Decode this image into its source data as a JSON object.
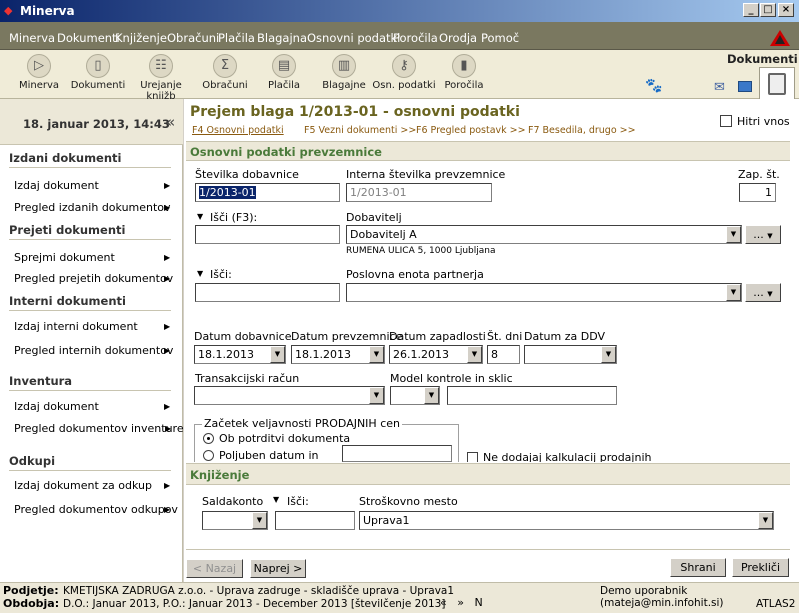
{
  "window": {
    "title": "Minerva"
  },
  "menu": [
    "Minerva",
    "Dokumenti",
    "Knjiženje",
    "Obračuni",
    "Plačila",
    "Blagajna",
    "Osnovni podatki",
    "Poročila",
    "Orodja",
    "Pomoč"
  ],
  "toolbar": {
    "buttons": [
      "Minerva",
      "Dokumenti",
      "Urejanje knjižb",
      "Obračuni",
      "Plačila",
      "Blagajne",
      "Osn. podatki",
      "Poročila"
    ],
    "tab_label": "Dokumenti"
  },
  "left": {
    "datetime": "18. januar 2013, 14:43",
    "collapse": "«",
    "sections": [
      {
        "title": "Izdani dokumenti",
        "items": [
          "Izdaj dokument",
          "Pregled izdanih dokumentov"
        ]
      },
      {
        "title": "Prejeti dokumenti",
        "items": [
          "Sprejmi dokument",
          "Pregled prejetih dokumentov"
        ]
      },
      {
        "title": "Interni dokumenti",
        "items": [
          "Izdaj interni dokument",
          "Pregled internih dokumentov"
        ]
      },
      {
        "title": "Inventura",
        "items": [
          "Izdaj dokument",
          "Pregled dokumentov inventure"
        ]
      },
      {
        "title": "Odkupi",
        "items": [
          "Izdaj dokument za odkup",
          "Pregled dokumentov odkupov"
        ]
      }
    ]
  },
  "main": {
    "title": "Prejem blaga 1/2013-01 - osnovni podatki",
    "quick_entry": "Hitri vnos",
    "tabs": [
      "F4 Osnovni podatki",
      "F5 Vezni dokumenti >>",
      "F6 Pregled postavk >>",
      "F7 Besedila, drugo >>"
    ],
    "section1": "Osnovni podatki prevzemnice",
    "stevilka_label": "Številka dobavnice",
    "stevilka_value": "1/2013-01",
    "interna_label": "Interna številka prevzemnice",
    "interna_value": "1/2013-01",
    "zap_label": "Zap. št.",
    "zap_value": "1",
    "isci_f3": "Išči (F3):",
    "dobavitelj_label": "Dobavitelj",
    "dobavitelj_value": "Dobavitelj A",
    "dobavitelj_address": "RUMENA ULICA 5, 1000 Ljubljana",
    "more": "...",
    "isci": "Išči:",
    "poslovna_label": "Poslovna enota partnerja",
    "datum_dob_label": "Datum dobavnice",
    "datum_dob": "18.1.2013",
    "datum_prev_label": "Datum prevzemnice",
    "datum_prev": "18.1.2013",
    "datum_zap_label": "Datum zapadlosti",
    "datum_zap": "26.1.2013",
    "st_dni_label": "Št. dni",
    "st_dni": "8",
    "datum_ddv_label": "Datum za DDV",
    "trr_label": "Transakcijski račun",
    "model_label": "Model kontrole in sklic",
    "group_title": "Začetek veljavnosti PRODAJNIH cen",
    "radio1": "Ob potrditvi dokumenta",
    "radio2": "Poljuben datum in čas",
    "no_calc": "Ne dodajaj kalkulacij prodajnih cen",
    "section2": "Knjiženje",
    "saldakonto_label": "Saldakonto",
    "isci2": "Išči:",
    "strosek_label": "Stroškovno mesto",
    "strosek_value": "Uprava1",
    "prev": "< Nazaj",
    "next": "Naprej >",
    "save": "Shrani",
    "cancel": "Prekliči"
  },
  "status": {
    "podjetje_label": "Podjetje:",
    "podjetje": "KMETIJSKA ZADRUGA z.o.o. - Uprava zadruge - skladišče uprava - Uprava1",
    "obdobja_label": "Obdobja:",
    "obdobja": "D.O.: Januar 2013, P.O.: Januar 2013 - December 2013 [številčenje 2013]",
    "nav": "«   »   N",
    "user": "Demo uporabnik (mateja@min.infohit.si)",
    "version": "ATLAS2"
  }
}
